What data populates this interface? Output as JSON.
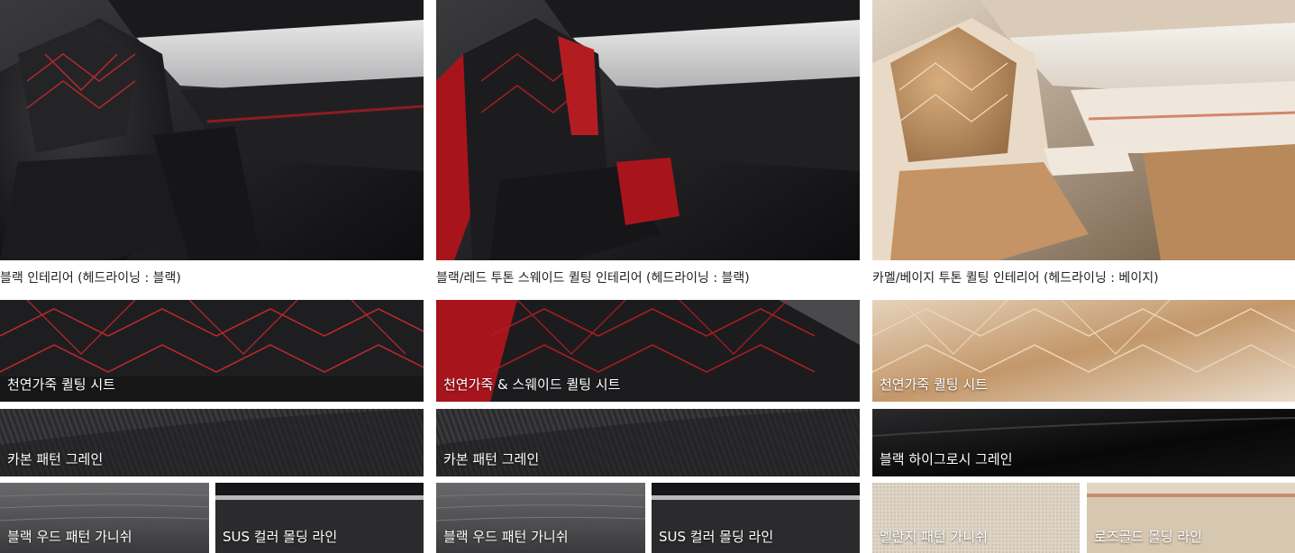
{
  "trims": [
    {
      "caption": "블랙 인테리어 (헤드라이닝 : 블랙)",
      "seat_label": "천연가죽 퀼팅 시트",
      "finish_label": "카본 패턴 그레인",
      "garnish_label": "블랙 우드 패턴 가니쉬",
      "molding_label": "SUS 컬러 몰딩 라인",
      "colors": {
        "seat": "#1e1e20",
        "stitch": "#c0282d",
        "finish": "#2a2a2c",
        "garnish": "#5a5a5c",
        "molding": "#2b2b2d"
      }
    },
    {
      "caption": "블랙/레드 투톤 스웨이드 퀼팅 인테리어 (헤드라이닝 : 블랙)",
      "seat_label": "천연가죽 & 스웨이드 퀼팅 시트",
      "finish_label": "카본 패턴 그레인",
      "garnish_label": "블랙 우드 패턴 가니쉬",
      "molding_label": "SUS 컬러 몰딩 라인",
      "colors": {
        "seat": "#1c1c1e",
        "stitch": "#b31d22",
        "finish": "#2a2a2c",
        "garnish": "#5a5a5c",
        "molding": "#2b2b2d"
      }
    },
    {
      "caption": "카멜/베이지 투톤 퀼팅 인테리어 (헤드라이닝 : 베이지)",
      "seat_label": "천연가죽 퀼팅 시트",
      "finish_label": "블랙 하이그로시 그레인",
      "garnish_label": "멜란지 패턴 가니쉬",
      "molding_label": "로즈골드 몰딩 라인",
      "colors": {
        "seat": "#c59a6c",
        "stitch": "#e9d2b4",
        "finish": "#0c0c0d",
        "garnish": "#d9d0c2",
        "molding": "#d6c7b0"
      }
    }
  ]
}
